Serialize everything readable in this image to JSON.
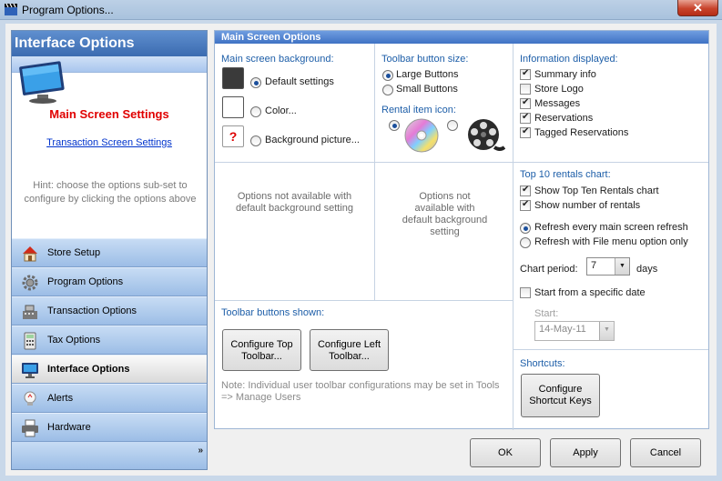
{
  "window": {
    "title": "Program Options...",
    "close_label": "✕"
  },
  "left": {
    "header": "Interface Options",
    "current_setting": "Main Screen Settings",
    "link": "Transaction Screen Settings",
    "hint": "Hint: choose the options sub-set to configure by clicking the options above",
    "nav": [
      {
        "label": "Store Setup",
        "icon": "house-icon"
      },
      {
        "label": "Program Options",
        "icon": "gear-icon"
      },
      {
        "label": "Transaction Options",
        "icon": "cash-register-icon"
      },
      {
        "label": "Tax Options",
        "icon": "calculator-icon"
      },
      {
        "label": "Interface Options",
        "icon": "monitor-icon",
        "active": true
      },
      {
        "label": "Alerts",
        "icon": "alert-bulb-icon"
      },
      {
        "label": "Hardware",
        "icon": "printer-icon"
      }
    ],
    "more": "»"
  },
  "main": {
    "header": "Main Screen Options",
    "background": {
      "label": "Main screen background:",
      "options": [
        "Default settings",
        "Color...",
        "Background picture..."
      ],
      "selected": 0,
      "picture_placeholder": "?"
    },
    "toolbar_size": {
      "label": "Toolbar button size:",
      "options": [
        "Large Buttons",
        "Small Buttons"
      ],
      "selected": 0
    },
    "rental_icon": {
      "label": "Rental item icon:",
      "options": [
        "disc-icon",
        "film-reel-icon"
      ],
      "selected": 0
    },
    "info": {
      "label": "Information displayed:",
      "items": [
        {
          "label": "Summary info",
          "checked": true
        },
        {
          "label": "Store Logo",
          "checked": false
        },
        {
          "label": "Messages",
          "checked": true
        },
        {
          "label": "Reservations",
          "checked": true
        },
        {
          "label": "Tagged Reservations",
          "checked": true
        }
      ]
    },
    "note_left": "Options not available with default background setting",
    "note_right": "Options not available with default background setting",
    "top10": {
      "label": "Top 10 rentals chart:",
      "show_chart": {
        "label": "Show Top Ten Rentals chart",
        "checked": true
      },
      "show_number": {
        "label": "Show number of rentals",
        "checked": true
      },
      "refresh_options": [
        "Refresh every main screen refresh",
        "Refresh with File menu option only"
      ],
      "refresh_selected": 0,
      "period_label": "Chart period:",
      "period_value": "7",
      "period_unit": "days",
      "start_specific": {
        "label": "Start from a specific date",
        "checked": false
      },
      "start_label": "Start:",
      "start_value": "14-May-11"
    },
    "toolbar_shown": {
      "label": "Toolbar buttons shown:",
      "btn_top": "Configure Top Toolbar...",
      "btn_left": "Configure Left Toolbar...",
      "note": "Note: Individual user toolbar configurations may be set in Tools => Manage Users"
    },
    "shortcuts": {
      "label": "Shortcuts:",
      "button": "Configure Shortcut Keys"
    }
  },
  "footer": {
    "ok": "OK",
    "apply": "Apply",
    "cancel": "Cancel"
  },
  "colors": {
    "accent": "#3f72c4",
    "nav_blue": "#9cbde6",
    "red": "#e00000"
  }
}
